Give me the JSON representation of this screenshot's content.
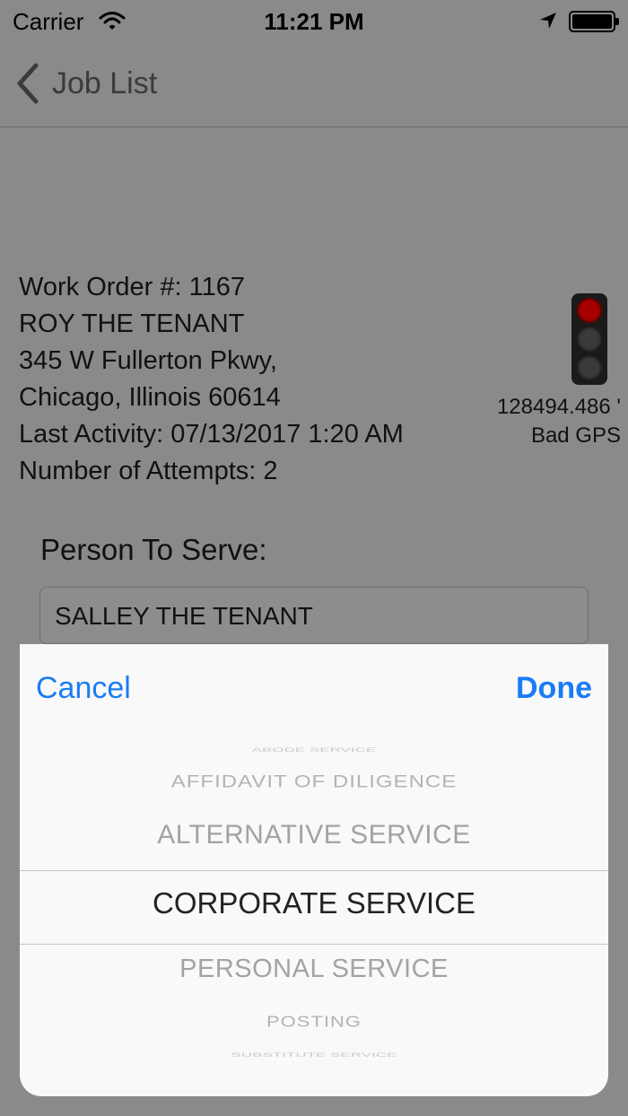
{
  "status_bar": {
    "carrier": "Carrier",
    "time": "11:21 PM"
  },
  "nav": {
    "back_label": "Job List"
  },
  "job": {
    "work_order": "Work Order #: 1167",
    "name": "ROY THE TENANT",
    "address_line1": "345 W Fullerton Pkwy,",
    "address_line2": "Chicago, Illinois 60614",
    "last_activity": "Last Activity: 07/13/2017 1:20 AM",
    "attempts": "Number of Attempts: 2"
  },
  "gps": {
    "distance": "128494.486 '",
    "status": "Bad GPS",
    "light_state": "red",
    "colors": {
      "red": "#a80000",
      "off": "#3a3a3a"
    }
  },
  "form": {
    "person_label": "Person To Serve:",
    "person_value": "SALLEY THE TENANT"
  },
  "picker": {
    "cancel_label": "Cancel",
    "done_label": "Done",
    "options": [
      "ABODE SERVICE",
      "AFFIDAVIT OF DILIGENCE",
      "ALTERNATIVE SERVICE",
      "CORPORATE SERVICE",
      "PERSONAL SERVICE",
      "POSTING",
      "SUBSTITUTE SERVICE"
    ],
    "selected": "CORPORATE SERVICE",
    "accent_color": "#1a7cf5"
  }
}
